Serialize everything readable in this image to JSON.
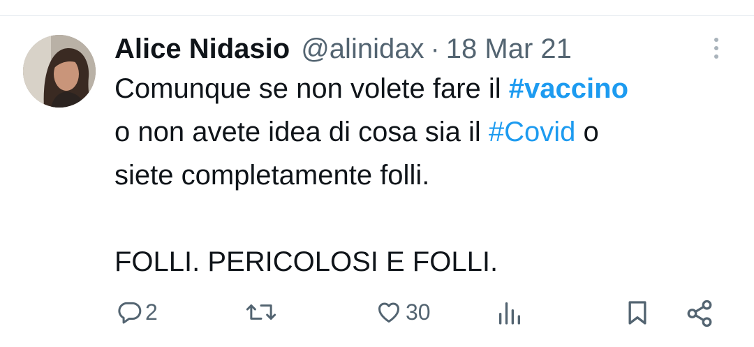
{
  "tweet": {
    "display_name": "Alice Nidasio",
    "handle": "@alinidax",
    "separator": "·",
    "date": "18 Mar 21",
    "text": {
      "line1_prefix": "Comunque se non volete fare il ",
      "hashtag1": "#vaccino",
      "line2_prefix": "o non avete idea di cosa sia il ",
      "hashtag2": "#Covid",
      "line2_suffix": " o",
      "line3": "siete completamente folli.",
      "line5": "FOLLI. PERICOLOSI E FOLLI."
    }
  },
  "actions": {
    "reply_count": "2",
    "retweet_count": "",
    "like_count": "30"
  },
  "icons": {
    "reply": "reply-icon",
    "retweet": "retweet-icon",
    "like": "heart-icon",
    "views": "views-icon",
    "bookmark": "bookmark-icon",
    "share": "share-icon",
    "more": "more-vertical-icon"
  },
  "colors": {
    "text": "#0f1419",
    "secondary": "#536471",
    "link": "#1d9bf0",
    "divider": "#e6ecf0"
  }
}
